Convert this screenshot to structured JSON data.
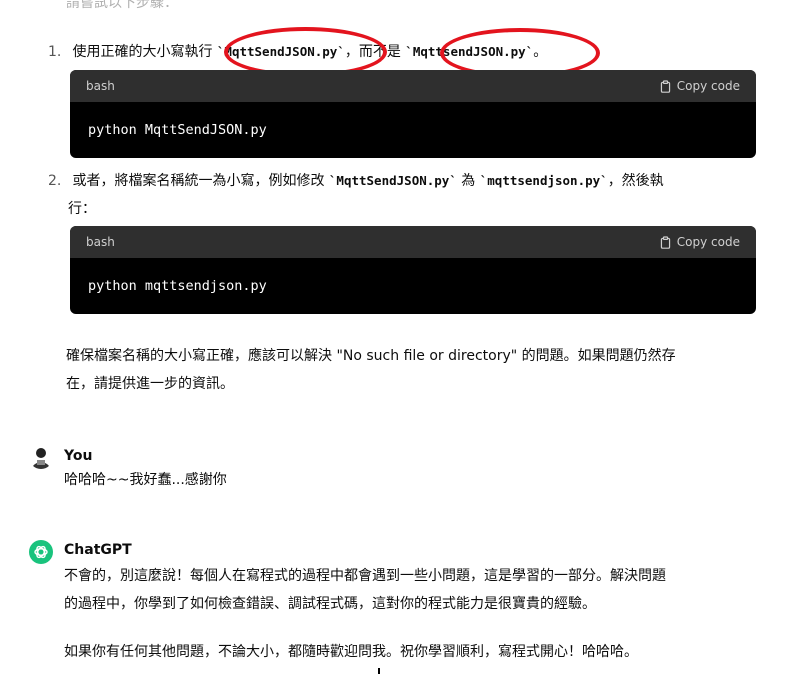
{
  "top_faded_text": "請嘗試以下步驟：",
  "steps": [
    {
      "number": "1.",
      "text_before": "使用正確的大小寫執行 ",
      "code1": "`MqttSendJSON.py`",
      "text_middle": "，而不是 ",
      "code2": "`MqttsendJSON.py`",
      "text_after": "。"
    },
    {
      "number": "2.",
      "text_before": "或者，將檔案名稱統一為小寫，例如修改 ",
      "code1": "`MqttSendJSON.py`",
      "text_middle": " 為 ",
      "code2": "`mqttsendjson.py`",
      "text_after": "，然後執",
      "text_line2": "行："
    }
  ],
  "code_blocks": [
    {
      "lang": "bash",
      "copy_label": "Copy code",
      "code": "python MqttSendJSON.py"
    },
    {
      "lang": "bash",
      "copy_label": "Copy code",
      "code": "python mqttsendjson.py"
    }
  ],
  "closing_paragraph": {
    "line1": "確保檔案名稱的大小寫正確，應該可以解決 \"No such file or directory\" 的問題。如果問題仍然存",
    "line2": "在，請提供進一步的資訊。"
  },
  "user_message": {
    "author": "You",
    "text": "哈哈哈~~我好蠢...感謝你"
  },
  "assistant_message": {
    "author": "ChatGPT",
    "para1_line1": "不會的，別這麼說！每個人在寫程式的過程中都會遇到一些小問題，這是學習的一部分。解決問題",
    "para1_line2": "的過程中，你學到了如何檢查錯誤、調試程式碼，這對你的程式能力是很寶貴的經驗。",
    "para2": "如果你有任何其他問題，不論大小，都隨時歡迎問我。祝你學習順利，寫程式開心！哈哈哈。"
  },
  "colors": {
    "annotation_red": "#e3141e",
    "code_bg": "#000000",
    "code_header_bg": "#2f2f2f",
    "chatgpt_green": "#19c37d"
  }
}
